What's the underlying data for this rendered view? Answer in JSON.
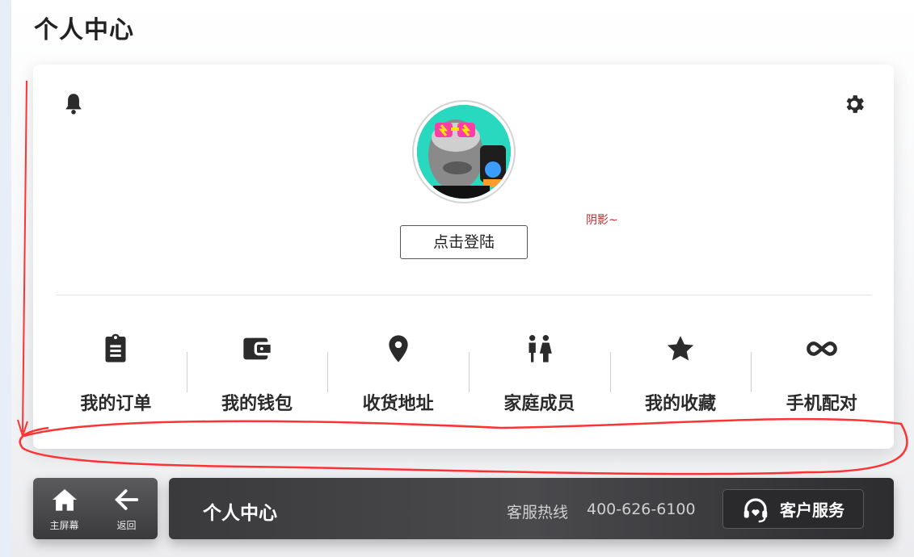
{
  "page": {
    "title": "个人中心"
  },
  "profile": {
    "login_label": "点击登陆",
    "note": "阴影~",
    "bell_icon": "bell-icon",
    "settings_icon": "gear-icon"
  },
  "menu": [
    {
      "label": "我的订单",
      "icon": "clipboard-icon"
    },
    {
      "label": "我的钱包",
      "icon": "wallet-icon"
    },
    {
      "label": "收货地址",
      "icon": "location-pin-icon"
    },
    {
      "label": "家庭成员",
      "icon": "family-icon"
    },
    {
      "label": "我的收藏",
      "icon": "star-icon"
    },
    {
      "label": "手机配对",
      "icon": "infinity-icon"
    }
  ],
  "nav": {
    "home_label": "主屏幕",
    "back_label": "返回"
  },
  "bar": {
    "title": "个人中心",
    "hotline_label": "客服热线",
    "hotline_number": "400-626-6100",
    "service_label": "客户服务"
  },
  "colors": {
    "annotation": "#ff3333",
    "bar_dark": "#3a3a3c"
  }
}
